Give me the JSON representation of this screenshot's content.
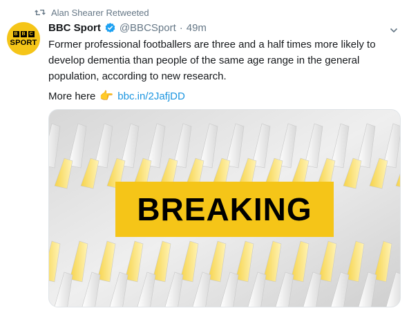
{
  "retweet": {
    "label": "Alan Shearer Retweeted",
    "icon": "retweet-icon"
  },
  "author": {
    "avatar_blocks": [
      "B",
      "B",
      "C"
    ],
    "avatar_text": "SPORT",
    "name": "BBC Sport",
    "handle": "@BBCSport",
    "separator": "·",
    "time": "49m",
    "verified": true
  },
  "tweet": {
    "text": "Former professional footballers are three and a half times more likely to develop dementia than people of the same age range in the general population, according to new research.",
    "more_label": "More here",
    "more_icon": "👉",
    "link": "bbc.in/2JafjDD"
  },
  "media": {
    "badge_text": "BREAKING",
    "colors": {
      "badge": "#f5c518",
      "text": "#000000"
    }
  },
  "colors": {
    "link": "#1b95e0",
    "muted": "#657786",
    "verified": "#1da1f2"
  }
}
